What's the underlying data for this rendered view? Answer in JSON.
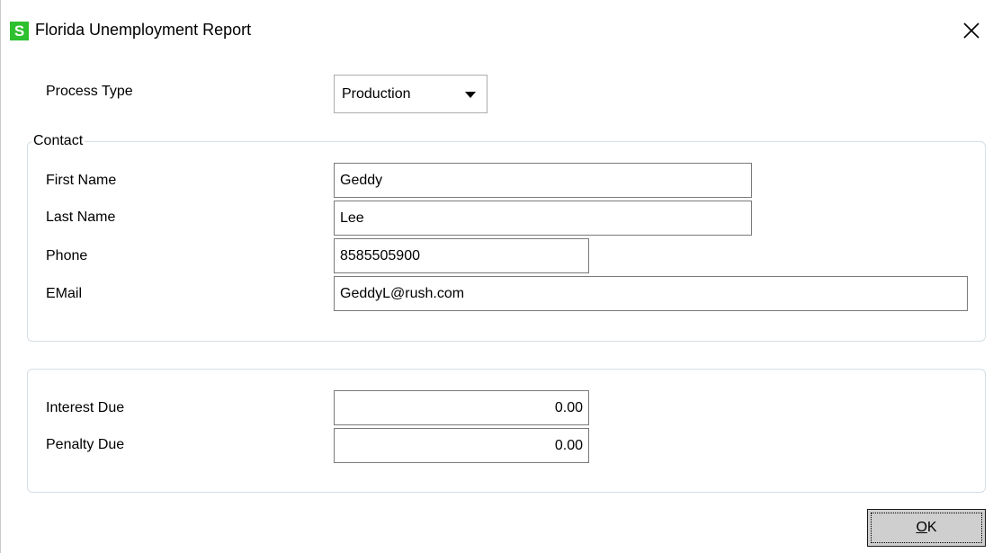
{
  "window": {
    "title": "Florida Unemployment Report",
    "app_icon_letter": "S",
    "close_glyph": "✕"
  },
  "process_type": {
    "label": "Process Type",
    "selected": "Production"
  },
  "contact": {
    "legend": "Contact",
    "first_name_label": "First Name",
    "first_name": "Geddy",
    "last_name_label": "Last Name",
    "last_name": "Lee",
    "phone_label": "Phone",
    "phone": "8585505900",
    "email_label": "EMail",
    "email": "GeddyL@rush.com"
  },
  "amounts": {
    "interest_label": "Interest Due",
    "interest": "0.00",
    "penalty_label": "Penalty Due",
    "penalty": "0.00"
  },
  "buttons": {
    "ok_underlined": "O",
    "ok_rest": "K"
  },
  "colors": {
    "app_icon_bg": "#2ec02e",
    "button_bg": "#cfcfcf",
    "group_border": "#d5dfe5"
  }
}
